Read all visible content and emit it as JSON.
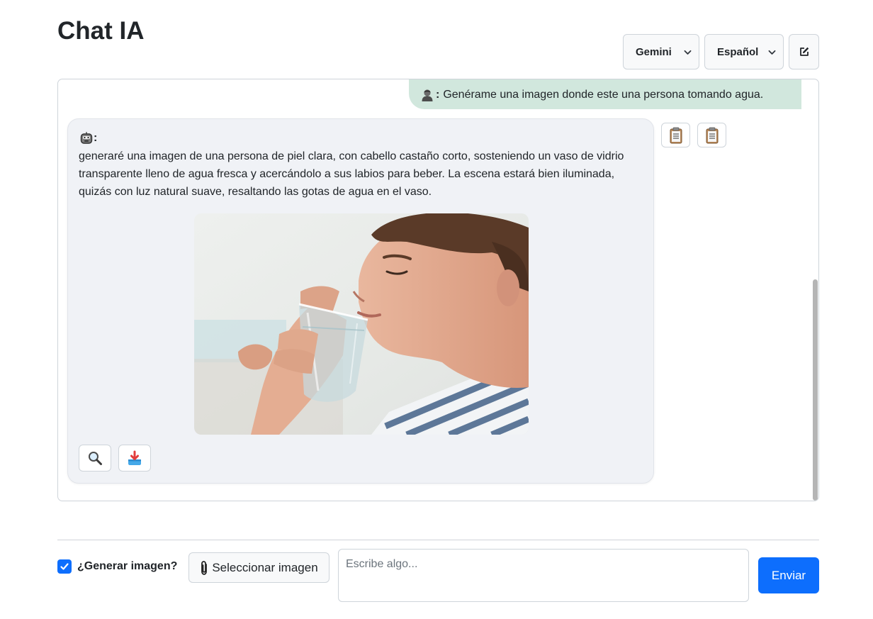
{
  "header": {
    "title": "Chat IA"
  },
  "toolbar": {
    "model_select": {
      "value": "Gemini",
      "icon": "chevron-down-icon"
    },
    "language_select": {
      "value": "Español",
      "icon": "chevron-down-icon"
    },
    "new_chat_icon": "edit-icon"
  },
  "chat": {
    "messages": [
      {
        "role": "user",
        "avatar": "user-avatar-icon",
        "sender_mark": ":",
        "text": "Genérame una imagen donde este una persona tomando agua."
      },
      {
        "role": "assistant",
        "avatar": "bot-avatar-icon",
        "sender_mark": ":",
        "text": " generaré una imagen de una persona de piel clara, con cabello castaño corto, sosteniendo un vaso de vidrio transparente lleno de agua fresca y acercándolo a sus labios para beber. La escena estará bien iluminada, quizás con luz natural suave, resaltando las gotas de agua en el vaso.",
        "image_actions": [
          "magnifier-icon",
          "download-icon"
        ],
        "copy_actions": [
          "clipboard-icon",
          "clipboard-icon"
        ]
      }
    ]
  },
  "composer": {
    "generate_image": {
      "label": "¿Generar imagen?",
      "checked": true
    },
    "select_image_label": "Seleccionar imagen",
    "select_image_icon": "paperclip-icon",
    "input_placeholder": "Escribe algo...",
    "input_value": "",
    "send_label": "Enviar"
  },
  "colors": {
    "primary": "#0d6efd",
    "user_bubble": "#d1e7dd",
    "bot_bubble": "#f0f2f6",
    "border": "#ced4da"
  }
}
